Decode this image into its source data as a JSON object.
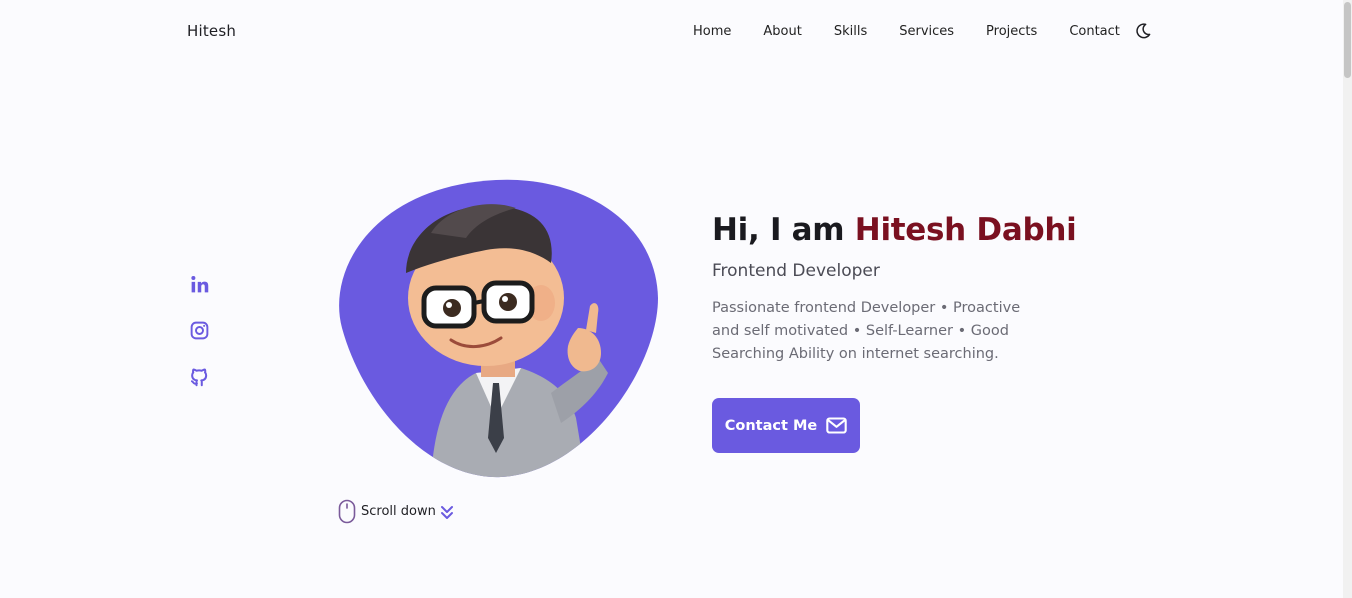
{
  "header": {
    "logo": "Hitesh",
    "nav": [
      {
        "label": "Home"
      },
      {
        "label": "About"
      },
      {
        "label": "Skills"
      },
      {
        "label": "Services"
      },
      {
        "label": "Projects"
      },
      {
        "label": "Contact"
      }
    ],
    "theme_toggle_icon": "moon-icon"
  },
  "social": [
    "linkedin-icon",
    "instagram-icon",
    "github-icon"
  ],
  "hero": {
    "greeting": "Hi, I am",
    "name": "Hitesh Dabhi",
    "subtitle": "Frontend Developer",
    "description": "Passionate frontend Developer • Proactive and self motivated • Self-Learner • Good Searching Ability on internet searching.",
    "contact_button": "Contact Me",
    "scroll_label": "Scroll down"
  },
  "colors": {
    "accent": "#6a5ae0",
    "name": "#7a1020",
    "background": "#fbfbfe"
  }
}
